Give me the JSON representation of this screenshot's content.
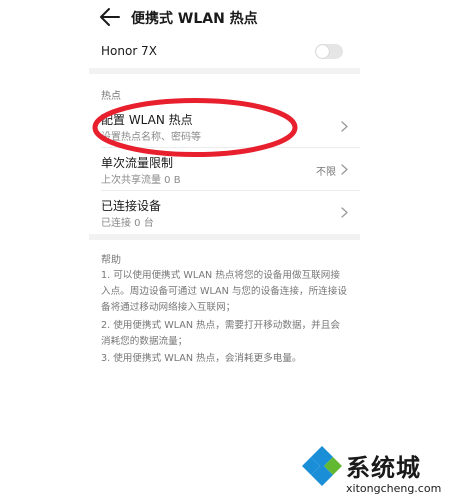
{
  "header": {
    "title": "便携式 WLAN 热点"
  },
  "hotspot": {
    "device_name": "Honor 7X",
    "enabled": false
  },
  "section": {
    "label": "热点"
  },
  "settings": [
    {
      "title": "配置 WLAN 热点",
      "subtitle": "设置热点名称、密码等",
      "value": ""
    },
    {
      "title": "单次流量限制",
      "subtitle": "上次共享流量 0 B",
      "value": "不限"
    },
    {
      "title": "已连接设备",
      "subtitle": "已连接 0 台",
      "value": ""
    }
  ],
  "help": {
    "title": "帮助",
    "items": [
      "1. 可以使用便携式 WLAN 热点将您的设备用做互联网接入点。周边设备可通过 WLAN 与您的设备连接，所连接设备将通过移动网络接入互联网；",
      "2. 使用便携式 WLAN 热点，需要打开移动数据，并且会消耗您的数据流量；",
      "3. 使用便携式 WLAN 热点，会消耗更多电量。"
    ]
  },
  "watermark": {
    "name": "系统城",
    "domain": "xitongcheng.com"
  },
  "colors": {
    "highlight": "#e8202e",
    "toggle_off": "#e5e5e5",
    "logo_blue": "#1a8fd8",
    "logo_green": "#63b832"
  },
  "icons": [
    "back-arrow-icon",
    "chevron-right-icon"
  ]
}
